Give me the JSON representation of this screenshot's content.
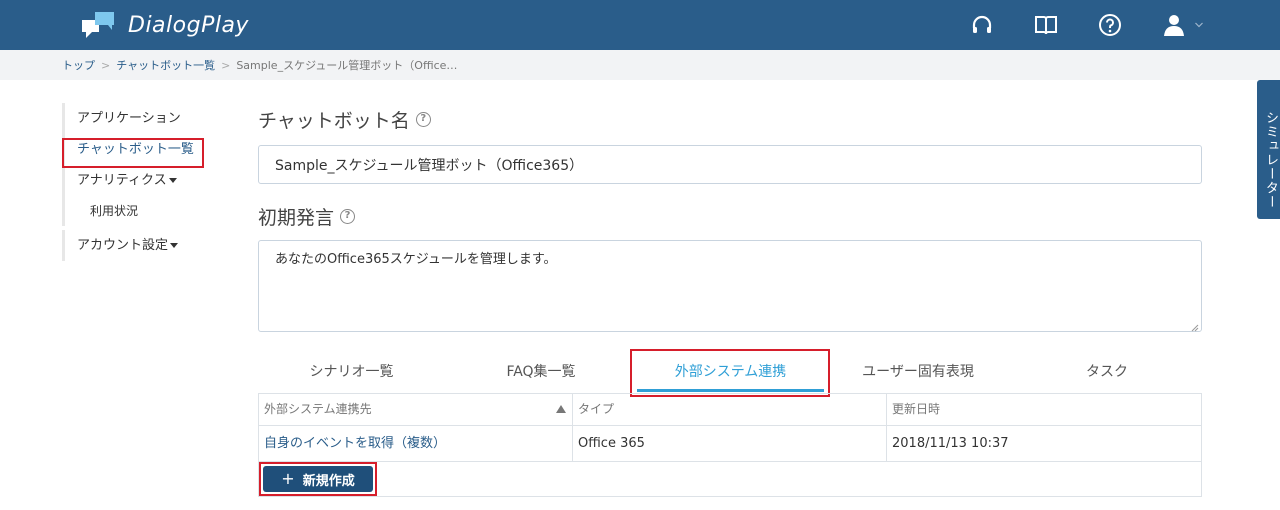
{
  "header": {
    "app_name": "DialogPlay",
    "icons": [
      "headset-icon",
      "book-icon",
      "help-circle-icon",
      "user-icon",
      "chevron-down-icon"
    ],
    "brand_color": "#2a5d8a"
  },
  "breadcrumb": {
    "items": [
      "トップ",
      "チャットボット一覧"
    ],
    "current": "Sample_スケジュール管理ボット（Office…",
    "separator": ">"
  },
  "sidebar": {
    "items": [
      {
        "label": "アプリケーション"
      },
      {
        "label": "チャットボット一覧"
      },
      {
        "label": "アナリティクス"
      },
      {
        "label": "利用状況"
      },
      {
        "label": "アカウント設定"
      }
    ]
  },
  "form": {
    "name_label": "チャットボット名",
    "name_value": "Sample_スケジュール管理ボット（Office365）",
    "greeting_label": "初期発言",
    "greeting_value": "あなたのOffice365スケジュールを管理します。",
    "help_glyph": "?"
  },
  "tabs": {
    "items": [
      "シナリオ一覧",
      "FAQ集一覧",
      "外部システム連携",
      "ユーザー固有表現",
      "タスク"
    ],
    "active": "外部システム連携",
    "active_color": "#2f9fd6"
  },
  "table": {
    "headers": [
      "外部システム連携先",
      "タイプ",
      "更新日時"
    ],
    "rows": [
      [
        "自身のイベントを取得（複数）",
        "Office 365",
        "2018/11/13 10:37"
      ]
    ]
  },
  "new_button": {
    "plus": "+",
    "label": "新規作成"
  },
  "simulator_tab": {
    "label": "シミュレーター"
  },
  "highlight_color": "#d61e2b"
}
